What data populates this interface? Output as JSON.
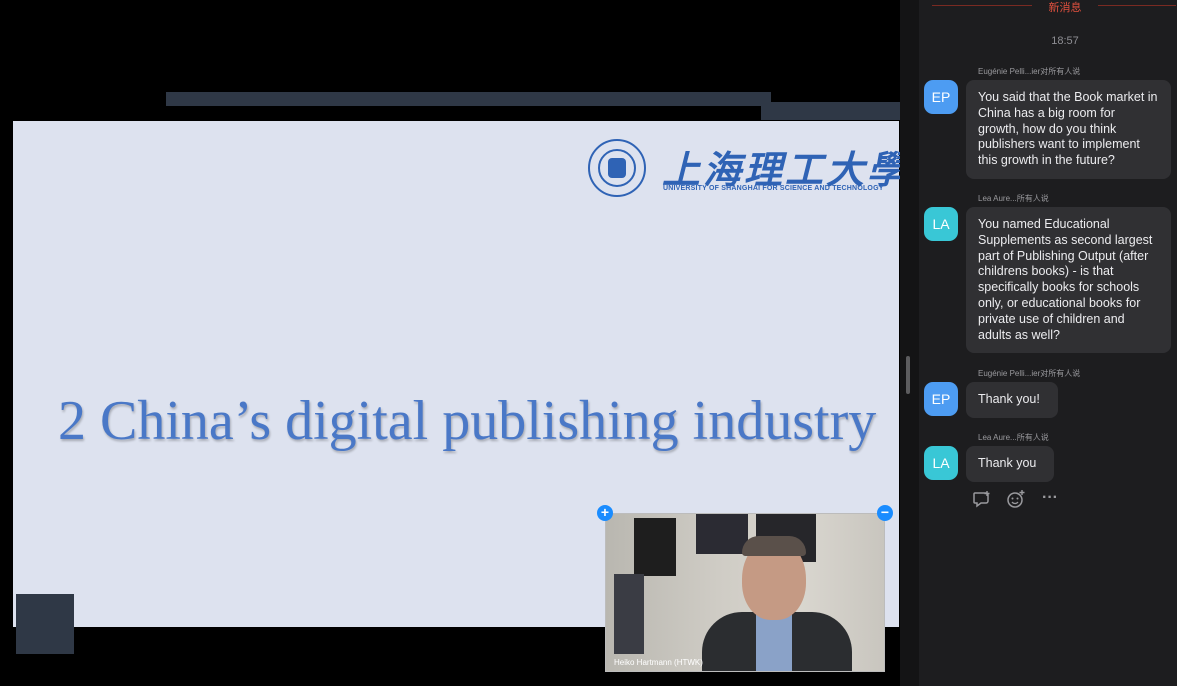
{
  "slide": {
    "logo_cn": "上海理工大學",
    "logo_en": "UNIVERSITY OF SHANGHAI FOR SCIENCE AND TECHNOLOGY",
    "title": "2 China’s digital publishing industry"
  },
  "video": {
    "participant_name": "Heiko Hartmann (HTWK)",
    "expand_symbol": "+",
    "collapse_symbol": "−"
  },
  "chat": {
    "new_messages_label": "新消息",
    "time": "18:57",
    "messages": [
      {
        "sender": "Eugénie Pelli...ier对所有人说",
        "initials": "EP",
        "text": "You said that the Book market in China has a big room for growth, how do you think publishers want to implement this growth in the future?"
      },
      {
        "sender": "Lea Aure...所有人说",
        "initials": "LA",
        "text": "You named Educational Supplements as second largest part of Publishing Output (after childrens books) - is that specifically books for schools only, or educational books for private use of children and adults as well?"
      },
      {
        "sender": "Eugénie Pelli...ier对所有人说",
        "initials": "EP",
        "text": "Thank you!"
      },
      {
        "sender": "Lea Aure...所有人说",
        "initials": "LA",
        "text": "Thank you"
      }
    ],
    "actions": {
      "reply_icon": "reply-icon",
      "emoji_icon": "add-reaction-icon",
      "more_icon": "more-icon",
      "more_symbol": "···"
    },
    "colors": {
      "ep_avatar": "#4d9cf2",
      "la_avatar": "#39c7d6",
      "new_messages": "#e0503e",
      "bubble": "#303033"
    }
  }
}
